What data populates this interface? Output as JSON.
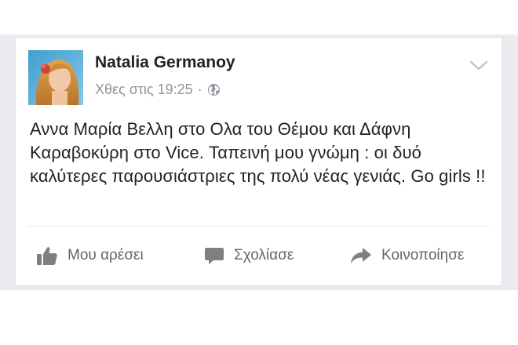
{
  "post": {
    "author": "Natalia Germanoy",
    "timestamp": "Χθες στις 19:25",
    "separator": "·",
    "privacy_icon": "globe-icon",
    "menu_icon": "chevron-down-icon",
    "text": "Αννα Μαρία Βελλη στο Ολα του Θέμου και Δάφνη Καραβοκύρη στο Vice. Ταπεινή μου γνώμη : οι δυό καλύτερες παρουσιάστριες της πολύ νέας γενιάς. Go girls !!"
  },
  "actions": {
    "like_label": "Μου αρέσει",
    "comment_label": "Σχολίασε",
    "share_label": "Κοινοποίησε"
  },
  "colors": {
    "name": "#1d2129",
    "meta": "#90949c",
    "action": "#616770",
    "backdrop": "#e9ebee"
  }
}
